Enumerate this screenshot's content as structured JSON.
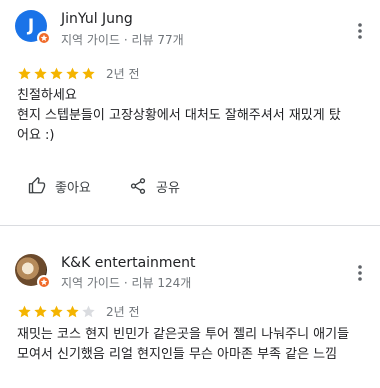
{
  "reviews": [
    {
      "avatar_letter": "J",
      "name": "JinYul Jung",
      "meta": "지역 가이드 · 리뷰 77개",
      "rating": 5,
      "date": "2년 전",
      "lines": [
        "친절하세요",
        "현지 스텝분들이 고장상황에서 대처도 잘해주셔서 재밌게 탔",
        "어요 :)"
      ],
      "like_label": "좋아요",
      "share_label": "공유"
    },
    {
      "name": "K&K entertainment",
      "meta": "지역 가이드 · 리뷰 124개",
      "rating": 4,
      "date": "2년 전",
      "lines": [
        "재밋는 코스 현지 빈민가 같은곳을 투어 젤리 나눠주니 애기들",
        "모여서 신기했음 리얼 현지인들 무슨 아마존 부족 같은 느낌"
      ]
    }
  ],
  "colors": {
    "star_filled": "#f4b400",
    "star_empty": "#dadce0",
    "avatar_blue": "#1a73e8",
    "guide_badge": "#f06b2a"
  },
  "icons": [
    "more-vert-icon",
    "thumb-up-icon",
    "share-icon",
    "guide-badge-icon",
    "star-icon"
  ]
}
